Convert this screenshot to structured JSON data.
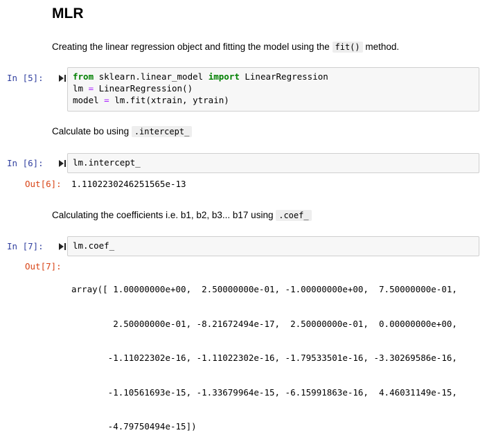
{
  "heading": "MLR",
  "md1": {
    "text": "Creating the linear regression object and fitting the model using the ",
    "code": "fit()",
    "suffix": " method."
  },
  "cell5": {
    "prompt": "In [5]:",
    "line1": {
      "kw1": "from",
      "mod": " sklearn.linear_model ",
      "kw2": "import",
      "name": " LinearRegression"
    },
    "line2": {
      "a": "lm ",
      "op": "=",
      "b": " LinearRegression()"
    },
    "line3": {
      "a": "model ",
      "op": "=",
      "b": " lm.fit(xtrain, ytrain)"
    }
  },
  "md2": {
    "text": "Calculate bo using ",
    "code": ".intercept_"
  },
  "cell6": {
    "prompt": "In [6]:",
    "code": "lm.intercept_",
    "out_prompt": "Out[6]:",
    "output": "1.1102230246251565e-13"
  },
  "md3": {
    "text": "Calculating the coefficients i.e. b1, b2, b3... b17 using ",
    "code": ".coef_"
  },
  "cell7": {
    "prompt": "In [7]:",
    "code": "lm.coef_",
    "out_prompt": "Out[7]:",
    "output_lines": [
      "array([ 1.00000000e+00,  2.50000000e-01, -1.00000000e+00,  7.50000000e-01,",
      "        2.50000000e-01, -8.21672494e-17,  2.50000000e-01,  0.00000000e+00,",
      "       -1.11022302e-16, -1.11022302e-16, -1.79533501e-16, -3.30269586e-16,",
      "       -1.10561693e-15, -1.33679964e-15, -6.15991863e-16,  4.46031149e-15,",
      "       -4.79750494e-15])"
    ]
  },
  "colors": {
    "in_prompt": "#303f9f",
    "out_prompt": "#d84315",
    "keyword": "#008000",
    "operator": "#aa22ff"
  },
  "icons": {
    "run": "run-cell-icon"
  }
}
